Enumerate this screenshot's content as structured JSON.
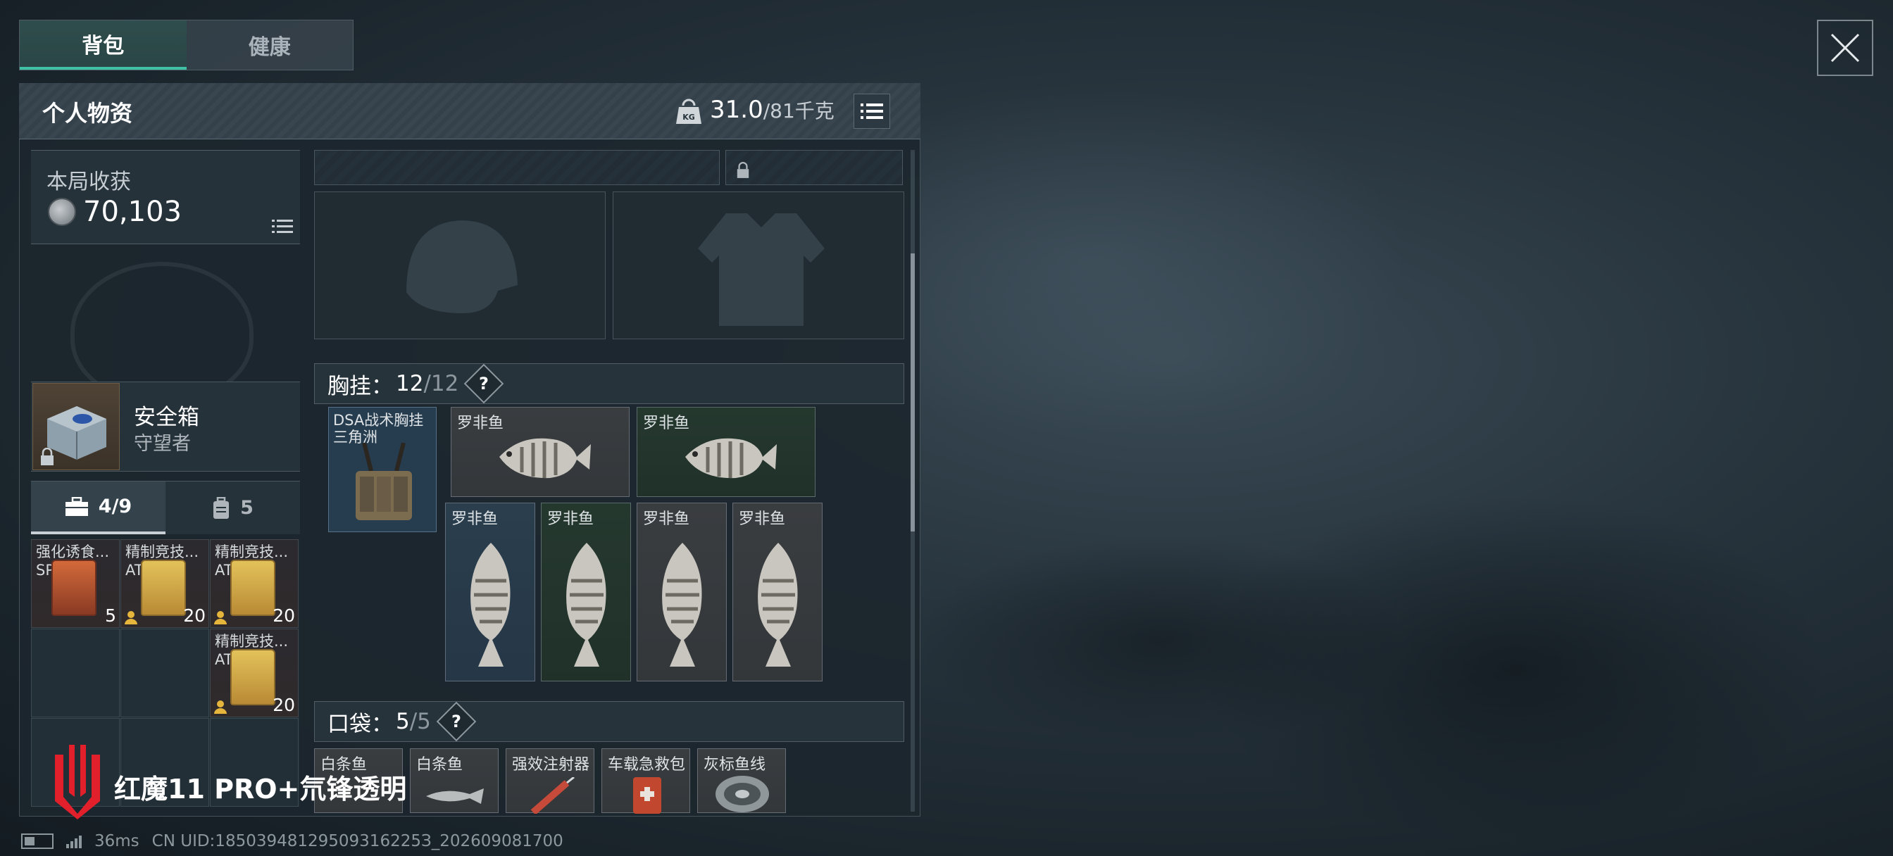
{
  "tabs": [
    "背包",
    "健康"
  ],
  "panel": {
    "title": "个人物资",
    "weight_current": "31.0",
    "weight_max": "/81千克"
  },
  "harvest": {
    "label": "本局收获",
    "value": "70,103"
  },
  "safebox": {
    "name": "安全箱",
    "sub": "守望者"
  },
  "subtabs": [
    {
      "icon": "briefcase-icon",
      "label": "4/9"
    },
    {
      "icon": "backpack-icon",
      "label": "5"
    }
  ],
  "left_items": [
    {
      "name": "强化诱食...",
      "sub": "SP",
      "count": "5"
    },
    {
      "name": "精制竞技...",
      "sub": "AT",
      "count": "20"
    },
    {
      "name": "精制竞技...",
      "sub": "AT",
      "count": "20"
    },
    {
      "name": "精制竞技...",
      "sub": "AT",
      "count": "20"
    }
  ],
  "chest_rig": {
    "section_label": "胸挂：",
    "count": "12",
    "max": "/12",
    "help": "?",
    "rig_name": "DSA战术胸挂三角洲",
    "items": [
      "罗非鱼",
      "罗非鱼",
      "罗非鱼",
      "罗非鱼",
      "罗非鱼",
      "罗非鱼"
    ]
  },
  "pocket": {
    "section_label": "口袋：",
    "count": "5",
    "max": "/5",
    "help": "?",
    "items": [
      "白条鱼",
      "白条鱼",
      "强效注射器",
      "车载急救包",
      "灰标鱼线"
    ]
  },
  "watermark": "红魔11 PRO+氘锋透明",
  "status": {
    "ping": "36ms",
    "uid": "CN UID:18503948129509316225З_202609081700"
  }
}
